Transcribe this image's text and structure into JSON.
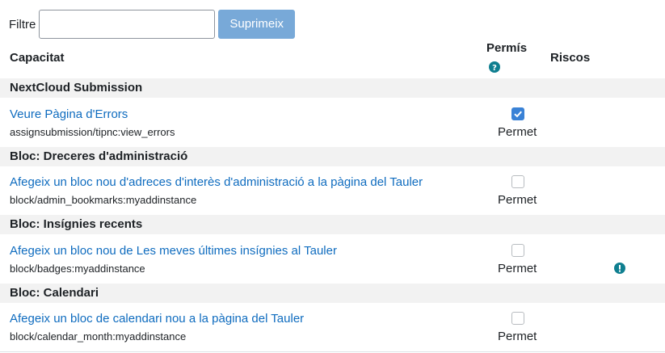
{
  "filter": {
    "label": "Filtre",
    "value": "",
    "placeholder": "",
    "clear_label": "Suprimeix"
  },
  "table": {
    "headers": {
      "capability": "Capacitat",
      "permission": "Permís",
      "risks": "Riscos"
    },
    "groups": [
      {
        "title": "NextCloud Submission",
        "capability": {
          "title": "Veure Pàgina d'Errors",
          "name": "assignsubmission/tipnc:view_errors",
          "checked": true,
          "perm": "Permet",
          "risk": ""
        }
      },
      {
        "title": "Bloc: Dreceres d'administració",
        "capability": {
          "title": "Afegeix un bloc nou d'adreces d'interès d'administració a la pàgina del Tauler",
          "name": "block/admin_bookmarks:myaddinstance",
          "checked": false,
          "perm": "Permet",
          "risk": ""
        }
      },
      {
        "title": "Bloc: Insígnies recents",
        "capability": {
          "title": "Afegeix un bloc nou de Les meves últimes insígnies al Tauler",
          "name": "block/badges:myaddinstance",
          "checked": false,
          "perm": "Permet",
          "risk": "warning-icon"
        }
      },
      {
        "title": "Bloc: Calendari",
        "capability": {
          "title": "Afegeix un bloc de calendari nou a la pàgina del Tauler",
          "name": "block/calendar_month:myaddinstance",
          "checked": false,
          "perm": "Permet",
          "risk": ""
        }
      }
    ]
  },
  "colors": {
    "link": "#0f6cbf",
    "checkbox_checked": "#3a82d6",
    "button": "#78a9d8",
    "icon": "#0f7f90"
  },
  "icons": {
    "help": "help-icon",
    "risk": "warning-icon"
  }
}
